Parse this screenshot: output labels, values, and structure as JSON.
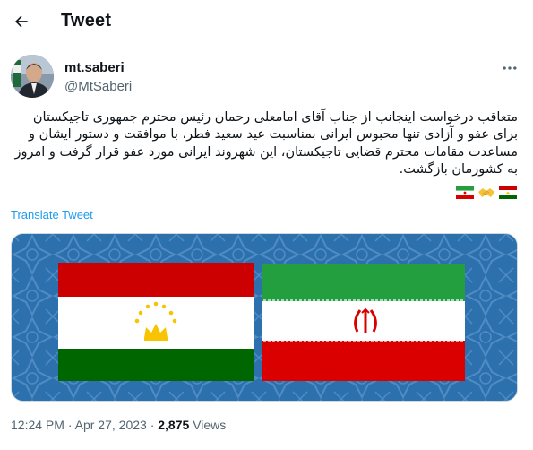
{
  "header": {
    "back_icon": "arrow-left-icon",
    "title": "Tweet"
  },
  "author": {
    "display_name": "mt.saberi",
    "handle": "@MtSaberi",
    "more_icon": "more-horizontal-icon"
  },
  "tweet": {
    "text": "متعاقب درخواست اینجانب از جناب آقای امامعلی رحمان رئیس محترم جمهوری تاجیکستان برای عفو و آزادی تنها محبوس ایرانی بمناسبت عید سعید فطر، با موافقت و دستور ایشان و مساعدت مقامات محترم قضایی تاجیکستان، این شهروند ایرانی مورد عفو قرار گرفت و امروز به کشورمان بازگشت.",
    "emojis": [
      "flag-iran-icon",
      "handshake-icon",
      "flag-tajikistan-icon"
    ],
    "translate_label": "Translate Tweet"
  },
  "media": {
    "description_icons": [
      "flag-tajikistan-icon",
      "flag-iran-icon"
    ]
  },
  "meta": {
    "time": "12:24 PM",
    "date": "Apr 27, 2023",
    "separator": "·",
    "views_count": "2,875",
    "views_label": "Views"
  },
  "colors": {
    "accent": "#1d9bf0",
    "secondary_text": "#536471",
    "tajik_red": "#cc0000",
    "tajik_green": "#006600",
    "tajik_crown": "#f8c300",
    "iran_green": "#239f40",
    "iran_red": "#da0000",
    "media_background": "#2d70ae"
  }
}
